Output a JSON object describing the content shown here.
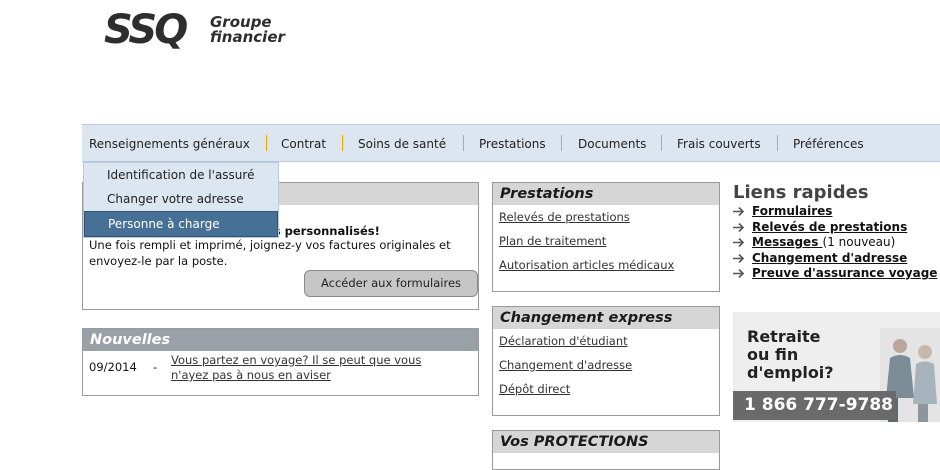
{
  "logo": {
    "mark": "SSQ",
    "line1": "Groupe",
    "line2": "financier"
  },
  "nav": [
    "Renseignements généraux",
    "Contrat",
    "Soins de santé",
    "Prestations",
    "Documents",
    "Frais couverts",
    "Préférences"
  ],
  "dropdown": [
    "Identification de l'assuré",
    "Changer votre adresse",
    "Personne à charge"
  ],
  "forms": {
    "bold_text": "es personnalisés!",
    "description": "Une fois rempli et imprimé, joignez-y vos factures originales et envoyez-le par la poste.",
    "button": "Accéder aux formulaires"
  },
  "news": {
    "title": "Nouvelles",
    "date": "09/2014",
    "dash": "-",
    "link": "Vous partez en voyage? Il se peut que vous n'ayez pas à nous en aviser"
  },
  "prestations": {
    "title": "Prestations",
    "links": [
      "Relevés de prestations",
      "Plan de traitement",
      "Autorisation articles médicaux"
    ]
  },
  "changement": {
    "title": "Changement express",
    "links": [
      "Déclaration d'étudiant",
      "Changement d'adresse",
      "Dépôt direct"
    ]
  },
  "protections": {
    "title": "Vos PROTECTIONS"
  },
  "liens": {
    "title": "Liens rapides",
    "items": [
      "Formulaires",
      "Relevés de prestations",
      "Messages ",
      "Changement d'adresse",
      "Preuve d'assurance voyage"
    ],
    "messages_count": "(1 nouveau)"
  },
  "banner": {
    "line1": "Retraite",
    "line2": "ou fin",
    "line3": "d'emploi?",
    "phone": "1 866 777-9788"
  },
  "colors": {
    "nav_bg": "#dbe6f1",
    "nav_separator": "#f4a300",
    "active_item": "#477097",
    "box_header": "#d6d6d6",
    "news_header": "#9aa0a7"
  },
  "icons": [
    "arrow-right-icon"
  ]
}
